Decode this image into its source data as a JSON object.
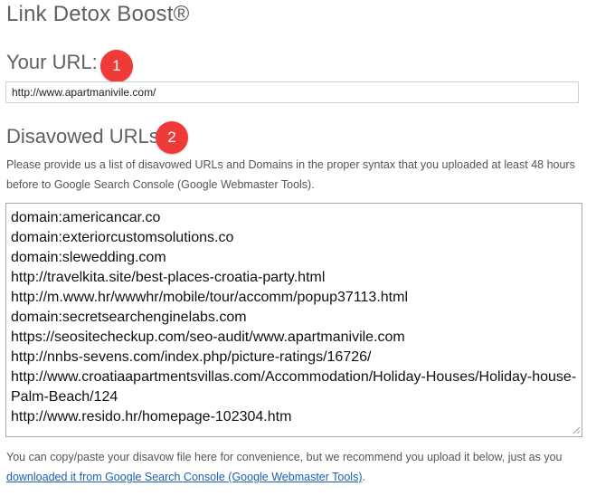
{
  "page_title": "Link Detox Boost®",
  "url_section": {
    "heading": "Your URL:",
    "badge": "1",
    "input_value": "http://www.apartmanivile.com/"
  },
  "disavow_section": {
    "heading": "Disavowed URLs:",
    "badge": "2",
    "description": "Please provide us a list of disavowed URLs and Domains in the proper syntax that you uploaded at least 48 hours before to Google Search Console (Google Webmaster Tools).",
    "textarea_value": "domain:americancar.co\ndomain:exteriorcustomsolutions.co\ndomain:slewedding.com\nhttp://travelkita.site/best-places-croatia-party.html\nhttp://m.www.hr/wwwhr/mobile/tour/accomm/popup37113.html\ndomain:secretsearchenginelabs.com\nhttps://seositecheckup.com/seo-audit/www.apartmanivile.com\nhttp://nnbs-sevens.com/index.php/picture-ratings/16726/\nhttp://www.croatiaapartmentsvillas.com/Accommodation/Holiday-Houses/Holiday-house-Palm-Beach/124\nhttp://www.resido.hr/homepage-102304.htm",
    "footer_text": "You can copy/paste your disavow file here for convenience, but we recommend you upload it below, just as you ",
    "footer_link": "downloaded it from Google Search Console (Google Webmaster Tools)",
    "footer_end": "."
  },
  "colors": {
    "badge": "#ee3b37",
    "link": "#1a5fb4",
    "heading": "#606060"
  }
}
